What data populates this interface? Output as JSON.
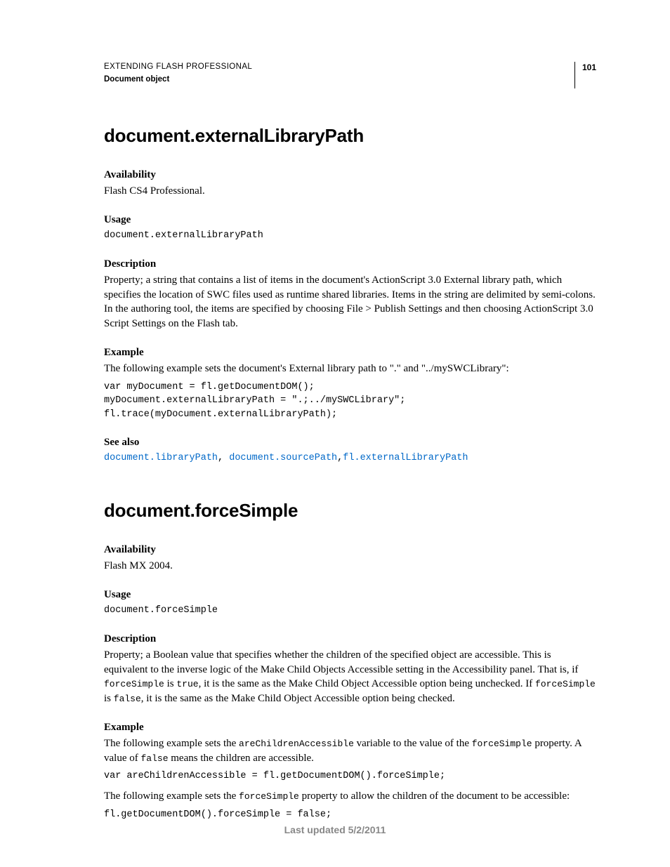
{
  "header": {
    "book_title": "EXTENDING FLASH PROFESSIONAL",
    "section": "Document object",
    "page_number": "101"
  },
  "entries": [
    {
      "title": "document.externalLibraryPath",
      "availability_label": "Availability",
      "availability_text": "Flash CS4 Professional.",
      "usage_label": "Usage",
      "usage_code": "document.externalLibraryPath",
      "description_label": "Description",
      "description_text": "Property; a string that contains a list of items in the document's ActionScript 3.0 External library path, which specifies the location of SWC files used as runtime shared libraries. Items in the string are delimited by semi-colons. In the authoring tool, the items are specified by choosing File > Publish Settings and then choosing ActionScript 3.0 Script Settings on the Flash tab.",
      "example_label": "Example",
      "example_intro": "The following example sets the document's External library path to \".\" and \"../mySWCLibrary\":",
      "example_code": "var myDocument = fl.getDocumentDOM();\nmyDocument.externalLibraryPath = \".;../mySWCLibrary\";\nfl.trace(myDocument.externalLibraryPath);",
      "see_also_label": "See also",
      "see_also_links": {
        "l1": "document.libraryPath",
        "l2": "document.sourcePath",
        "l3": "fl.externalLibraryPath"
      }
    },
    {
      "title": "document.forceSimple",
      "availability_label": "Availability",
      "availability_text": "Flash MX 2004.",
      "usage_label": "Usage",
      "usage_code": "document.forceSimple",
      "description_label": "Description",
      "description_parts": {
        "p1": "Property; a Boolean value that specifies whether the children of the specified object are accessible. This is equivalent to the inverse logic of the Make Child Objects Accessible setting in the Accessibility panel. That is, if ",
        "c1": "forceSimple",
        "p2": " is ",
        "c2": "true",
        "p3": ", it is the same as the Make Child Object Accessible option being unchecked. If ",
        "c3": "forceSimple",
        "p4": " is ",
        "c4": "false",
        "p5": ", it is the same as the Make Child Object Accessible option being checked."
      },
      "example_label": "Example",
      "example_intro_parts": {
        "p1": "The following example sets the ",
        "c1": "areChildrenAccessible",
        "p2": " variable to the value of the ",
        "c2": "forceSimple",
        "p3": " property. A value of ",
        "c3": "false",
        "p4": " means the children are accessible."
      },
      "example_code_1": "var areChildrenAccessible = fl.getDocumentDOM().forceSimple;",
      "example_intro2_parts": {
        "p1": "The following example sets the ",
        "c1": "forceSimple",
        "p2": " property to allow the children of the document to be accessible:"
      },
      "example_code_2": "fl.getDocumentDOM().forceSimple = false;"
    }
  ],
  "footer": "Last updated 5/2/2011"
}
